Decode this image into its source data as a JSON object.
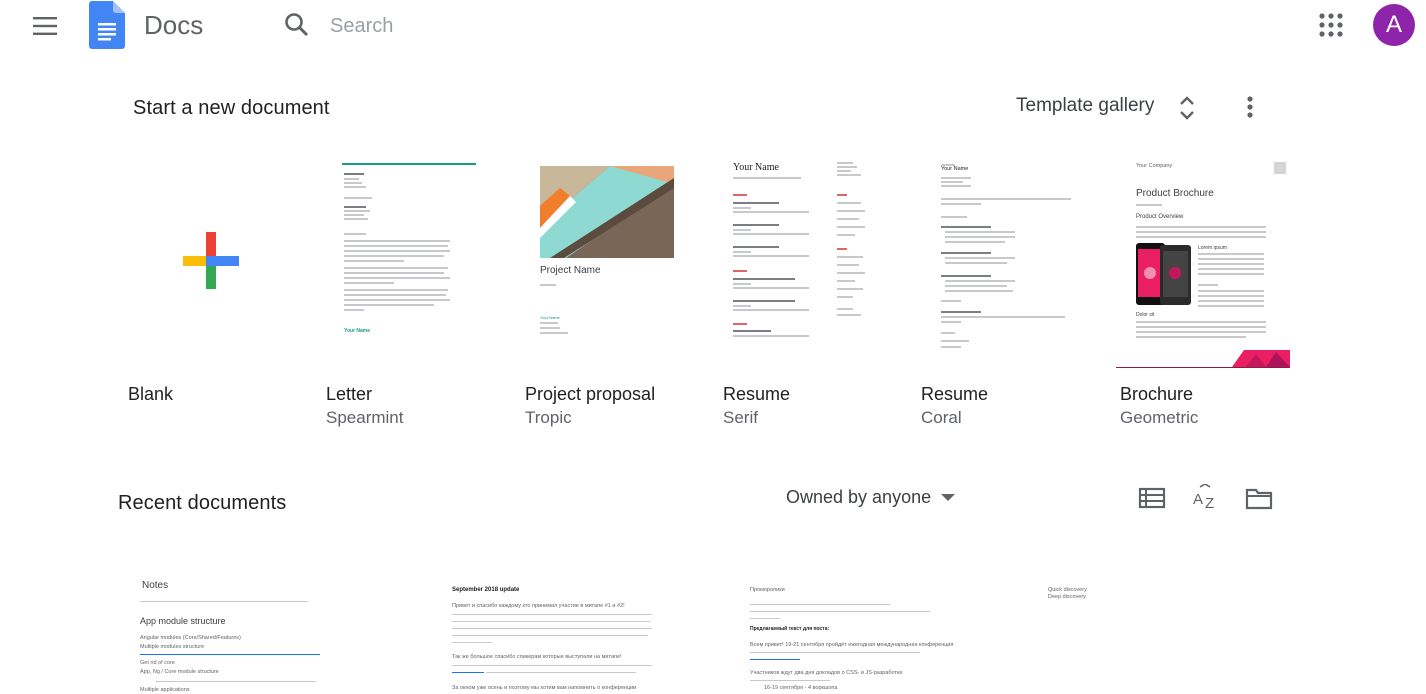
{
  "app": {
    "name": "Docs",
    "avatar_letter": "A",
    "avatar_color": "#8e24aa",
    "brand_color": "#4285f4"
  },
  "search": {
    "placeholder": "Search"
  },
  "templates": {
    "heading": "Start a new document",
    "gallery_label": "Template gallery",
    "items": [
      {
        "name": "Blank",
        "sub": ""
      },
      {
        "name": "Letter",
        "sub": "Spearmint"
      },
      {
        "name": "Project proposal",
        "sub": "Tropic"
      },
      {
        "name": "Resume",
        "sub": "Serif"
      },
      {
        "name": "Resume",
        "sub": "Coral"
      },
      {
        "name": "Brochure",
        "sub": "Geometric"
      }
    ],
    "thumb_text": {
      "letter_signature": "Your Name",
      "project_title": "Project Name",
      "project_author": "Your Name",
      "resume_serif_name": "Your Name",
      "coral_name": "Your Name",
      "brochure_company": "Your Company",
      "brochure_title": "Product Brochure",
      "brochure_overview": "Product Overview",
      "brochure_lorem": "Lorem ipsum",
      "brochure_dolor": "Dolor sit"
    }
  },
  "recent": {
    "heading": "Recent documents",
    "owner_filter": "Owned by anyone",
    "docs": [
      {
        "title": "Notes",
        "subtitle": "App module structure",
        "lines": [
          "Angular modules (Core/Shared/Features)",
          "Multiple modules structure",
          "Get rid of core",
          "App, Ng / Core module structure",
          "Multiple applications"
        ]
      },
      {
        "title": "September 2018 update",
        "lines": [
          "Привет и спасибо каждому кто принимал участие в митапе #1 и #2!",
          "Так же большое спасибо спикерам которые выступали на митапе!",
          "За окном уже осень и поэтому мы хотим вам напомнить о конференции"
        ]
      },
      {
        "title": "Проморолики",
        "side": [
          "Quick discovery",
          "Deep discovery"
        ],
        "subtitle": "Предлагаемый текст для поста:",
        "lines": [
          "Всем привет! 19-21 сентября пройдёт ежегодная международная конференция",
          "Участников ждут два дня докладов о CSS- и JS-разработке",
          "16-19 сентября - 4 воркшопа"
        ]
      }
    ]
  }
}
